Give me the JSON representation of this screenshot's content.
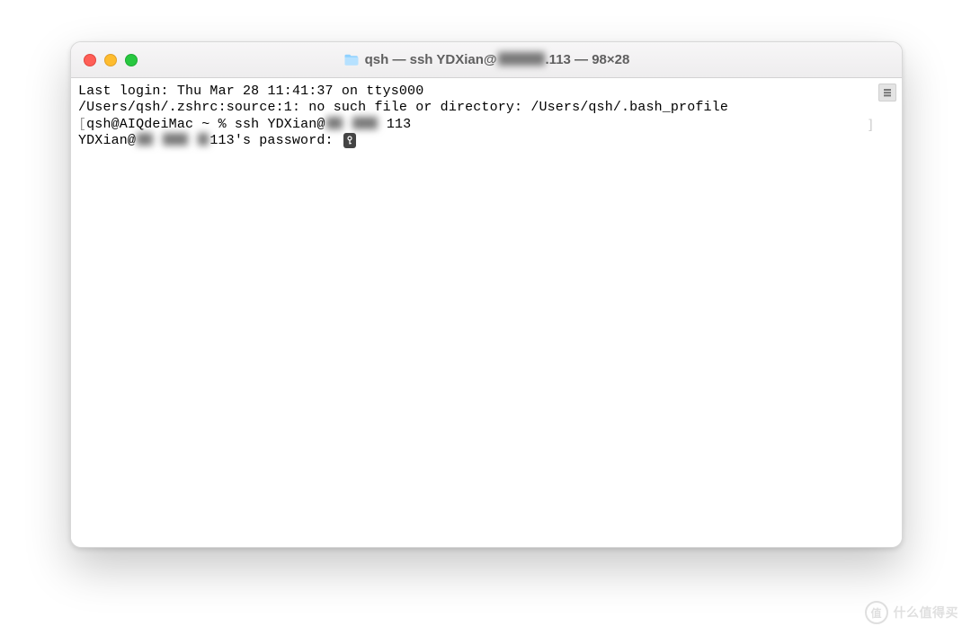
{
  "titlebar": {
    "title_prefix": "qsh — ssh YDXian@",
    "title_suffix": ".113 — 98×28"
  },
  "terminal": {
    "line1": "Last login: Thu Mar 28 11:41:37 on ttys000",
    "line2": "/Users/qsh/.zshrc:source:1: no such file or directory: /Users/qsh/.bash_profile",
    "line3_pre": "qsh@AIQdeiMac ~ % ssh YDXian@",
    "line3_post": "113",
    "line4_pre": "YDXian@",
    "line4_mid": "113's password: "
  },
  "watermark": {
    "badge": "值",
    "text": "什么值得买"
  }
}
